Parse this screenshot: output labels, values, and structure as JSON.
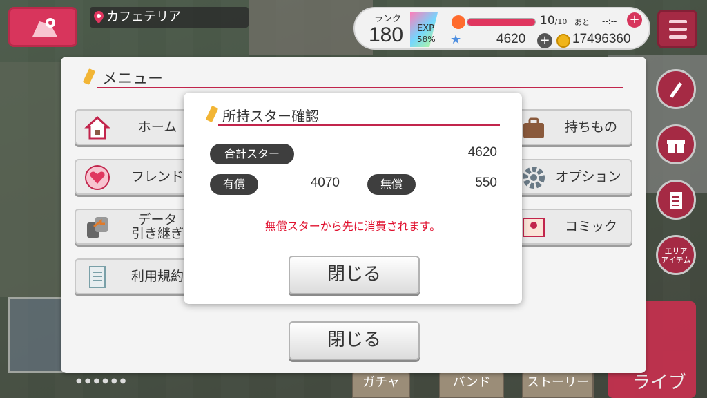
{
  "hud": {
    "location": "カフェテリア",
    "rank_label": "ランク",
    "rank_value": "180",
    "exp_label": "EXP",
    "exp_percent": "58%",
    "exp_fraction": 0.58,
    "life_value": "10",
    "life_max": "/10",
    "life_fraction": 1.0,
    "life_after": "あと",
    "life_timer": "--:--",
    "stars": "4620",
    "coins": "17496360"
  },
  "side": {
    "area_item": "エリア\nアイテム",
    "live_label": "ライブ"
  },
  "bottom_nav": [
    "ガチャ",
    "バンド",
    "ストーリー"
  ],
  "menu": {
    "title": "メニュー",
    "left_buttons": [
      {
        "label": "ホーム",
        "icon": "home-icon"
      },
      {
        "label": "フレンド",
        "icon": "friend-heart-icon"
      },
      {
        "label": "データ\n引き継ぎ",
        "icon": "data-transfer-icon"
      },
      {
        "label": "利用規約",
        "icon": "document-icon"
      }
    ],
    "right_buttons": [
      {
        "label": "持ちもの",
        "icon": "bag-icon"
      },
      {
        "label": "オプション",
        "icon": "gear-icon"
      },
      {
        "label": "コミック",
        "icon": "comic-icon"
      }
    ],
    "close_label": "閉じる"
  },
  "dialog": {
    "title": "所持スター確認",
    "total_label": "合計スター",
    "total_value": "4620",
    "paid_label": "有償",
    "paid_value": "4070",
    "free_label": "無償",
    "free_value": "550",
    "note": "無償スターから先に消費されます。",
    "close_label": "閉じる"
  },
  "colors": {
    "accent": "#c2254c",
    "note_red": "#e0102e",
    "pill_dark": "#3e3e3e"
  }
}
